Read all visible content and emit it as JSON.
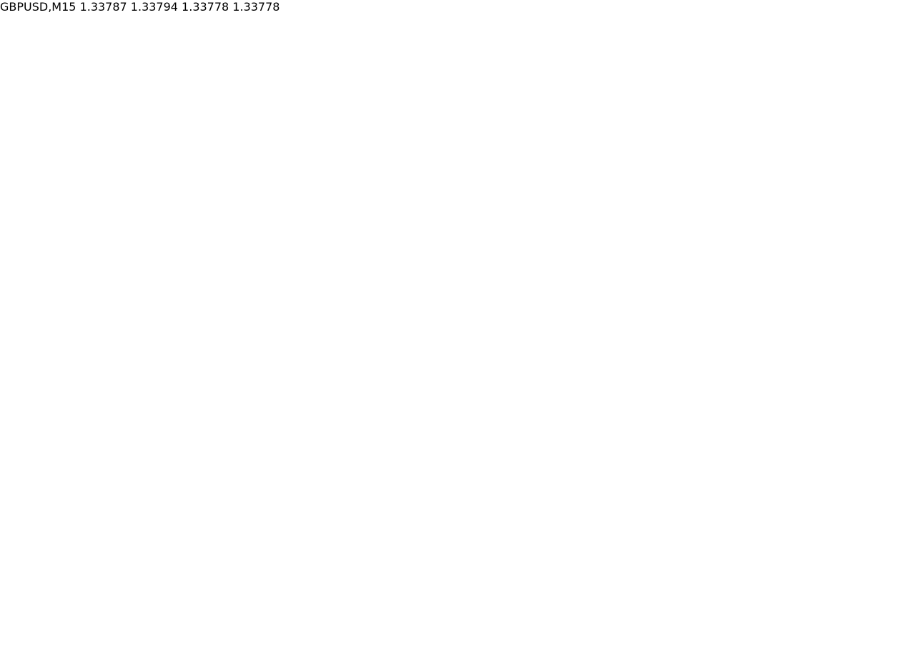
{
  "chart_data": {
    "type": "line",
    "title": "GBPUSD,M15  1.33787 1.33794 1.33778 1.33778"
  }
}
